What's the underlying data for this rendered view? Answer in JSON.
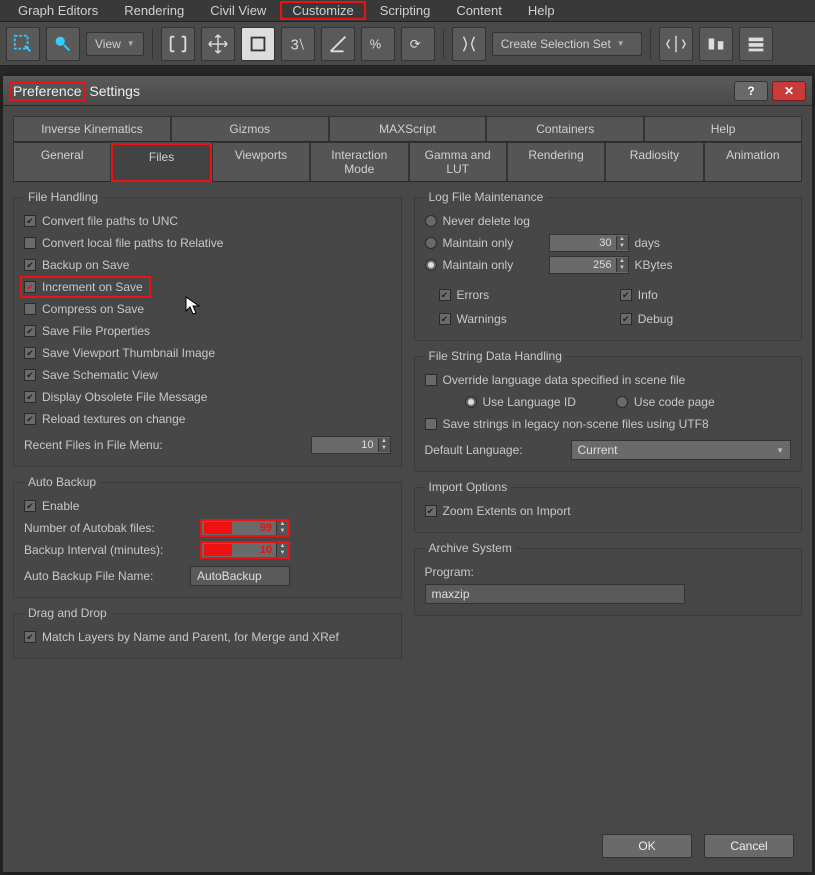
{
  "menu": [
    "Graph Editors",
    "Rendering",
    "Civil View",
    "Customize",
    "Scripting",
    "Content",
    "Help"
  ],
  "menu_highlight": "Customize",
  "toolbar": {
    "view_dd": "View",
    "selection_set_dd": "Create Selection Set"
  },
  "dialog": {
    "title_hl": "Preference",
    "title_rest": " Settings",
    "help_glyph": "?",
    "close_glyph": "✕"
  },
  "tabs_top": [
    "Inverse Kinematics",
    "Gizmos",
    "MAXScript",
    "Containers",
    "Help"
  ],
  "tabs_bottom": [
    "General",
    "Files",
    "Viewports",
    "Interaction Mode",
    "Gamma and LUT",
    "Rendering",
    "Radiosity",
    "Animation"
  ],
  "active_tab": "Files",
  "file_handling": {
    "legend": "File Handling",
    "items": [
      {
        "label": "Convert file paths to UNC",
        "checked": true
      },
      {
        "label": "Convert local file paths to Relative",
        "checked": false
      },
      {
        "label": "Backup on Save",
        "checked": true
      },
      {
        "label": "Increment on Save",
        "checked": true,
        "hl": true,
        "red": true
      },
      {
        "label": "Compress on Save",
        "checked": false
      },
      {
        "label": "Save File Properties",
        "checked": true
      },
      {
        "label": "Save Viewport Thumbnail Image",
        "checked": true
      },
      {
        "label": "Save Schematic View",
        "checked": true
      },
      {
        "label": "Display Obsolete File Message",
        "checked": true
      },
      {
        "label": "Reload textures on change",
        "checked": true
      }
    ],
    "recent_label": "Recent Files in File Menu:",
    "recent_value": "10"
  },
  "auto_backup": {
    "legend": "Auto Backup",
    "enable_label": "Enable",
    "enable_checked": true,
    "rows": [
      {
        "label": "Number of Autobak files:",
        "value": "99",
        "hl": true
      },
      {
        "label": "Backup Interval (minutes):",
        "value": "10",
        "hl": true
      }
    ],
    "file_label": "Auto Backup File Name:",
    "file_value": "AutoBackup"
  },
  "drag_drop": {
    "legend": "Drag and Drop",
    "item_label": "Match Layers by Name and Parent, for Merge and XRef",
    "item_checked": true
  },
  "log": {
    "legend": "Log File Maintenance",
    "radios": [
      {
        "label": "Never delete log",
        "checked": false
      },
      {
        "label": "Maintain only",
        "checked": false,
        "suffix": "days",
        "value": "30"
      },
      {
        "label": "Maintain only",
        "checked": true,
        "suffix": "KBytes",
        "value": "256"
      }
    ],
    "checks": [
      {
        "label": "Errors",
        "checked": true
      },
      {
        "label": "Info",
        "checked": true
      },
      {
        "label": "Warnings",
        "checked": true
      },
      {
        "label": "Debug",
        "checked": true
      }
    ]
  },
  "strdata": {
    "legend": "File String Data Handling",
    "override_label": "Override language data specified in scene file",
    "override_checked": false,
    "use_lang_id": "Use Language ID",
    "use_code_page": "Use code page",
    "lang_radio": "id",
    "save_utf8_label": "Save strings in legacy non-scene files using UTF8",
    "save_utf8_checked": false,
    "default_lang_label": "Default Language:",
    "default_lang_value": "Current"
  },
  "import": {
    "legend": "Import Options",
    "zoom_label": "Zoom Extents on Import",
    "zoom_checked": true
  },
  "archive": {
    "legend": "Archive System",
    "program_label": "Program:",
    "program_value": "maxzip"
  },
  "buttons": {
    "ok": "OK",
    "cancel": "Cancel"
  }
}
